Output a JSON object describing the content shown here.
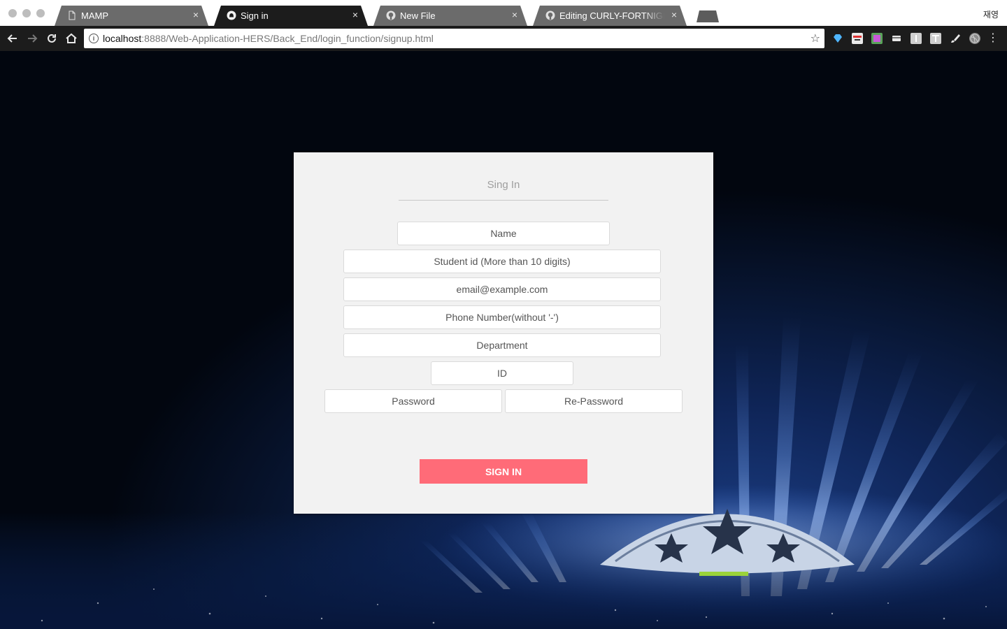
{
  "browser": {
    "tabs": [
      {
        "title": "MAMP",
        "icon": "document-icon",
        "active": false
      },
      {
        "title": "Sign in",
        "icon": "app-favicon-icon",
        "active": true
      },
      {
        "title": "New File",
        "icon": "github-icon",
        "active": false
      },
      {
        "title": "Editing CURLY-FORTNIGHT/RE",
        "icon": "github-icon",
        "active": false
      }
    ],
    "close_glyph": "×",
    "profile_name": "재영",
    "address": {
      "host": "localhost",
      "rest": ":8888/Web-Application-HERS/Back_End/login_function/signup.html"
    }
  },
  "form": {
    "title": "Sing In",
    "fields": {
      "name": "Name",
      "student_id": "Student id (More than 10 digits)",
      "email": "email@example.com",
      "phone": "Phone Number(without '-')",
      "department": "Department",
      "id": "ID",
      "password": "Password",
      "re_password": "Re-Password"
    },
    "submit_label": "SIGN IN"
  },
  "colors": {
    "submit_bg": "#ff6b78",
    "card_bg": "#f2f2f2",
    "toolbar_bg": "#1c1c1c"
  }
}
